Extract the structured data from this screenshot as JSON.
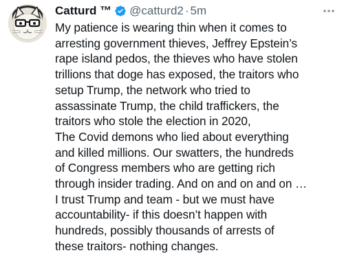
{
  "tweet": {
    "author": {
      "display_name": "Catturd ™",
      "handle": "@catturd2",
      "verified": true,
      "avatar_icon": "cat-avatar-icon"
    },
    "separator": "·",
    "timestamp": "5m",
    "more_icon": "more-dots-icon",
    "text_lines": [
      "My patience is wearing thin when it comes to",
      "arresting government thieves, Jeffrey Epstein’s",
      "rape island pedos, the thieves who have stolen",
      "trillions that doge has exposed, the traitors who",
      "setup Trump, the network who tried to",
      "assassinate Trump, the child traffickers, the",
      "traitors who stole the election in 2020,",
      "The Covid demons who lied about everything",
      "and killed millions. Our swatters, the hundreds",
      "of Congress members who are getting rich",
      "through insider trading. And on and on and on …",
      "I trust Trump and team - but we must have",
      "accountability- if this doesn’t happen with",
      "hundreds, possibly thousands of arrests of",
      "these traitors- nothing changes."
    ]
  },
  "colors": {
    "text_primary": "#0f1419",
    "text_secondary": "#536471",
    "verified_blue": "#1d9bf0",
    "background": "#ffffff"
  }
}
